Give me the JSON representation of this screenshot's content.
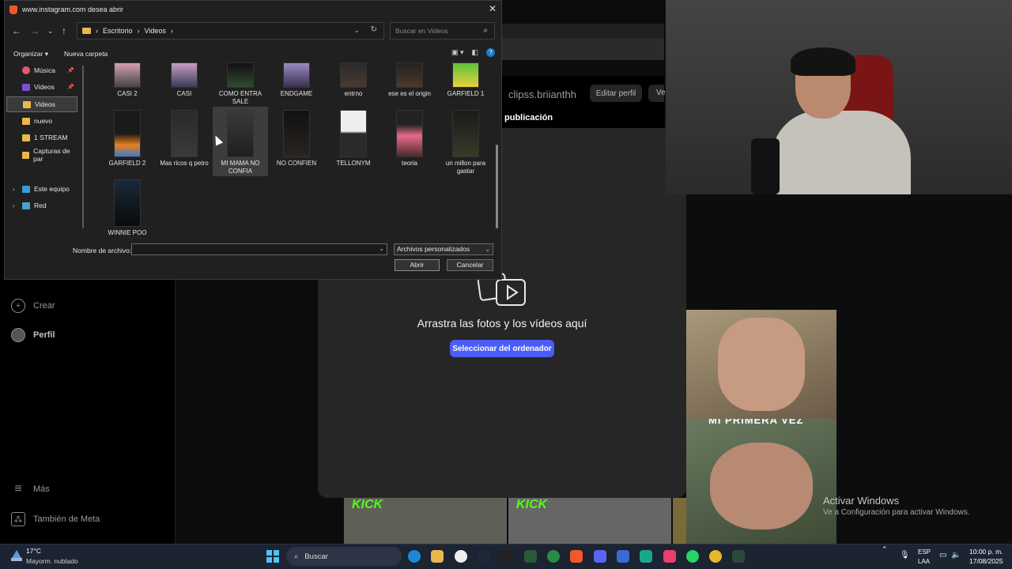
{
  "dialog": {
    "title": "www.instagram.com desea abrir",
    "breadcrumb": [
      "Escritorio",
      "Videos"
    ],
    "search_placeholder": "Buscar en Videos",
    "toolbar": {
      "organize": "Organizar",
      "new_folder": "Nueva carpeta"
    },
    "nav_items": [
      {
        "label": "Música",
        "pinned": true,
        "icon": "music-icon"
      },
      {
        "label": "Videos",
        "pinned": true,
        "icon": "video-folder-icon"
      },
      {
        "label": "Videos",
        "selected": true,
        "icon": "folder-icon"
      },
      {
        "label": "nuevo",
        "icon": "folder-icon"
      },
      {
        "label": "1 STREAM",
        "icon": "folder-icon"
      },
      {
        "label": "Capturas de par",
        "icon": "folder-icon"
      },
      {
        "label": "Este equipo",
        "icon": "computer-icon"
      },
      {
        "label": "Red",
        "icon": "network-icon"
      }
    ],
    "files": [
      {
        "name": "CASI 2"
      },
      {
        "name": "CASI"
      },
      {
        "name": "COMO ENTRA SALE"
      },
      {
        "name": "ENDGAME"
      },
      {
        "name": "entrno"
      },
      {
        "name": "ese es el origin"
      },
      {
        "name": "GARFIELD 1"
      },
      {
        "name": "GARFIELD 2"
      },
      {
        "name": "Mas ricos q petro"
      },
      {
        "name": "MI MAMA NO CONFIA",
        "selected": true
      },
      {
        "name": "NO CONFIEN"
      },
      {
        "name": "TELLONYM"
      },
      {
        "name": "teoria"
      },
      {
        "name": "un millon para gastar"
      },
      {
        "name": "WINNIE POO"
      }
    ],
    "filename_label": "Nombre de archivo:",
    "filename_value": "",
    "filter": "Archivos personalizados",
    "open": "Abrir",
    "cancel": "Cancelar"
  },
  "instagram": {
    "username": "clipss.briianthh",
    "edit_profile": "Editar perfil",
    "edit_profile2": "Ve",
    "new_post_title": "publicación",
    "drag_text": "Arrastra las fotos y los vídeos aquí",
    "select_button": "Seleccionar del ordenador",
    "nav": {
      "create": "Crear",
      "profile": "Perfil",
      "more": "Más",
      "meta": "También de Meta"
    },
    "thumb_caption": "MI PRIMERA VEZ",
    "kick1": "KICK",
    "kick2": "KICK"
  },
  "activate": {
    "title": "Activar Windows",
    "subtitle": "Ve a Configuración para activar Windows."
  },
  "taskbar": {
    "temp": "17°C",
    "weather": "Mayorm. nublado",
    "search": "Buscar",
    "lang1": "ESP",
    "lang2": "LAA",
    "time": "10:00 p. m.",
    "date": "17/08/2025"
  }
}
